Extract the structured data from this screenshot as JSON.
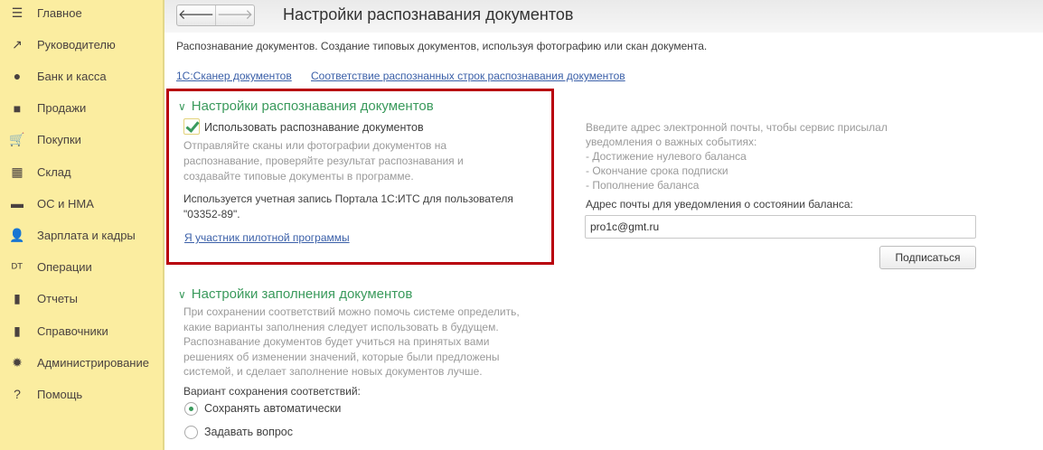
{
  "sidebar": {
    "items": [
      {
        "label": "Главное",
        "icon": "menu-icon"
      },
      {
        "label": "Руководителю",
        "icon": "trend-icon"
      },
      {
        "label": "Банк и касса",
        "icon": "ruble-icon"
      },
      {
        "label": "Продажи",
        "icon": "bag-icon"
      },
      {
        "label": "Покупки",
        "icon": "cart-icon"
      },
      {
        "label": "Склад",
        "icon": "warehouse-icon"
      },
      {
        "label": "ОС и НМА",
        "icon": "truck-icon"
      },
      {
        "label": "Зарплата и кадры",
        "icon": "person-icon"
      },
      {
        "label": "Операции",
        "icon": "dt-kt-icon"
      },
      {
        "label": "Отчеты",
        "icon": "bar-chart-icon"
      },
      {
        "label": "Справочники",
        "icon": "books-icon"
      },
      {
        "label": "Администрирование",
        "icon": "gear-icon"
      },
      {
        "label": "Помощь",
        "icon": "question-icon"
      }
    ]
  },
  "header": {
    "title": "Настройки распознавания документов",
    "back": "🡐",
    "forward": "🡒"
  },
  "description": "Распознавание документов. Создание типовых документов, используя фотографию или скан документа.",
  "links": [
    "1С:Сканер документов",
    "Соответствие распознанных строк распознавания документов"
  ],
  "recognition": {
    "title": "Настройки распознавания документов",
    "checkbox_label": "Использовать распознавание документов",
    "checked": true,
    "hint": [
      "Отправляйте сканы или фотографии документов на",
      "распознавание, проверяйте результат распознавания и",
      "создавайте типовые документы в программе."
    ],
    "account": [
      "Используется учетная запись Портала 1С:ИТС для пользователя",
      "\"03352-89\"."
    ],
    "pilot_link": "Я участник пилотной программы"
  },
  "notify": {
    "hint": [
      "Введите адрес электронной почты, чтобы сервис присылал",
      "уведомления о важных событиях:",
      "- Достижение нулевого баланса",
      "- Окончание срока подписки",
      "- Пополнение баланса"
    ],
    "email_label": "Адрес почты для уведомления о состоянии баланса:",
    "email": "pro1c@gmt.ru",
    "subscribe": "Подписаться"
  },
  "filling": {
    "title": "Настройки заполнения документов",
    "hint": [
      "При сохранении соответствий можно помочь системе определить,",
      "какие варианты заполнения следует использовать в будущем.",
      "Распознавание документов будет учиться на принятых вами",
      "решениях об изменении значений, которые были предложены",
      "системой, и сделает заполнение новых документов лучше."
    ],
    "variant_label": "Вариант сохранения соответствий:",
    "options": [
      "Сохранять автоматически",
      "Задавать вопрос"
    ],
    "selected": 0
  }
}
